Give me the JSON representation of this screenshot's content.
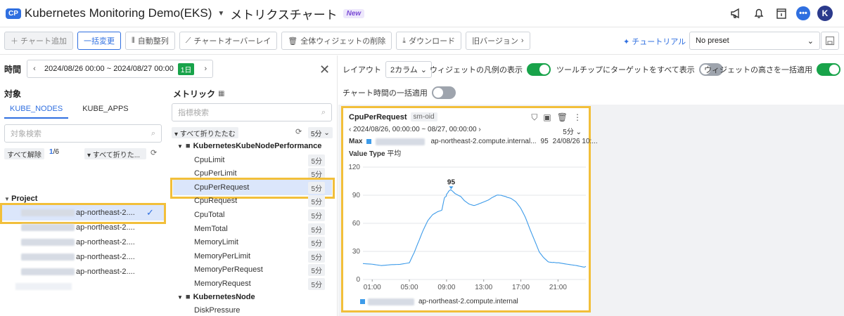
{
  "header": {
    "badge": "CP",
    "app_title": "Kubernetes Monitoring Demo(EKS)",
    "page_title": "メトリクスチャート",
    "new_badge": "New",
    "chat_label": "•••",
    "avatar_initial": "K"
  },
  "toolbar": {
    "add_chart": "＋ チャート追加",
    "bulk_change": "一括変更",
    "auto_arrange": "自動整列",
    "chart_overlay": "チャートオーバーレイ",
    "delete_all": "全体ウィジェットの削除",
    "download": "ダウンロード",
    "old_version": "旧バージョン",
    "tutorial": "チュートリアル",
    "preset": "No preset"
  },
  "time": {
    "label": "時間",
    "range": "2024/08/26 00:00 ~ 2024/08/27 00:00",
    "day_badge": "1日"
  },
  "target": {
    "title": "対象",
    "tabs": [
      "KUBE_NODES",
      "KUBE_APPS"
    ],
    "search_placeholder": "対象検索",
    "unselect_all": "すべて解除",
    "count_selected": "1",
    "count_total": "/6",
    "collapse_all": "▾ すべて折りた...",
    "group": "Project",
    "nodes": [
      {
        "suffix": "ap-northeast-2...."
      },
      {
        "suffix": "ap-northeast-2...."
      },
      {
        "suffix": "ap-northeast-2...."
      },
      {
        "suffix": "ap-northeast-2...."
      },
      {
        "suffix": "ap-northeast-2...."
      }
    ]
  },
  "metric": {
    "title": "メトリック",
    "search_placeholder": "指標検索",
    "collapse_all": "▾ すべて折りたたむ",
    "interval": "5分",
    "group1": "KubernetesKubeNodePerformance",
    "items": [
      {
        "name": "CpuLimit",
        "badge": "5分"
      },
      {
        "name": "CpuPerLimit",
        "badge": "5分"
      },
      {
        "name": "CpuPerRequest",
        "badge": "5分"
      },
      {
        "name": "CpuRequest",
        "badge": "5分"
      },
      {
        "name": "CpuTotal",
        "badge": "5分"
      },
      {
        "name": "MemTotal",
        "badge": "5分"
      },
      {
        "name": "MemoryLimit",
        "badge": "5分"
      },
      {
        "name": "MemoryPerLimit",
        "badge": "5分"
      },
      {
        "name": "MemoryPerRequest",
        "badge": "5分"
      },
      {
        "name": "MemoryRequest",
        "badge": "5分"
      }
    ],
    "group2": "KubernetesNode",
    "item_partial": "DiskPressure"
  },
  "options": {
    "layout_label": "レイアウト",
    "layout_value": "2カラム",
    "legend_label": "ウィジェットの凡例の表示",
    "tooltip_label": "ツールチップにターゲットをすべて表示",
    "height_label": "ウィジェットの高さを一括適用",
    "chart_time_label": "チャート時間の一括適用",
    "legend_on": true,
    "tooltip_on": false,
    "height_on": true,
    "chart_time_on": false
  },
  "widget": {
    "title": "CpuPerRequest",
    "tag": "sm-oid",
    "range": "2024/08/26, 00:00:00 ~ 08/27, 00:00:00",
    "interval": "5分",
    "max_label": "Max",
    "max_host": "ap-northeast-2.compute.internal...",
    "max_value": "95",
    "max_time": "24/08/26 10:...",
    "value_type_label": "Value Type",
    "value_type": "平均",
    "legend_host": "ap-northeast-2.compute.internal",
    "series_color": "#3d9be9"
  },
  "chart_data": {
    "type": "line",
    "x_ticks": [
      "01:00",
      "05:00",
      "09:00",
      "13:00",
      "17:00",
      "21:00"
    ],
    "y_ticks": [
      "120",
      "90",
      "60",
      "30",
      "0"
    ],
    "ylim": [
      0,
      120
    ],
    "xlim_hours": [
      0,
      24
    ],
    "peak_label": "95",
    "series": [
      {
        "x": [
          0,
          1,
          2,
          3,
          4,
          5,
          5.5,
          6,
          6.5,
          7,
          7.5,
          8,
          8.5,
          8.8,
          9,
          9.2,
          9.5,
          10,
          10.5,
          11,
          11.5,
          12,
          12.5,
          13,
          13.5,
          14,
          14.5,
          15,
          15.5,
          16,
          16.5,
          17,
          17.5,
          18,
          18.5,
          19,
          19.5,
          20,
          20.5,
          21,
          22,
          23,
          24
        ],
        "y": [
          17,
          17,
          16,
          17,
          17,
          18,
          28,
          40,
          52,
          62,
          68,
          71,
          73,
          88,
          90,
          93,
          95,
          91,
          89,
          84,
          81,
          80,
          82,
          84,
          86,
          89,
          91,
          90,
          88,
          86,
          82,
          75,
          65,
          52,
          40,
          28,
          22,
          18,
          18,
          18,
          17,
          16,
          14
        ]
      }
    ]
  }
}
